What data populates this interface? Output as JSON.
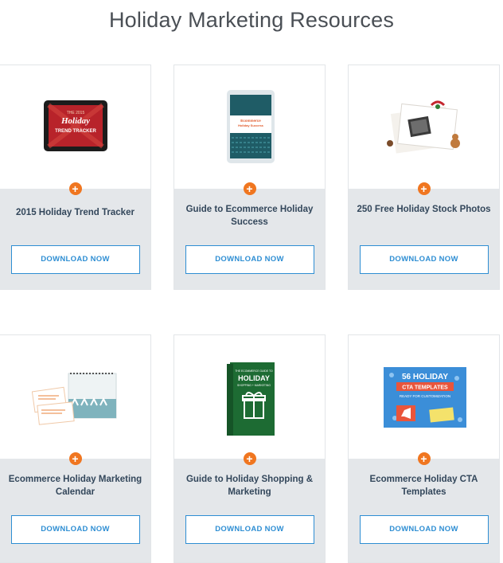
{
  "page": {
    "title": "Holiday Marketing Resources"
  },
  "cards": [
    {
      "title": "2015 Holiday Trend Tracker",
      "button": "DOWNLOAD NOW",
      "plus": "+",
      "thumb": {
        "line1": "THE 2015",
        "line2": "Holiday",
        "line3": "TREND TRACKER"
      }
    },
    {
      "title": "Guide to Ecommerce Holiday Success",
      "button": "DOWNLOAD NOW",
      "plus": "+",
      "thumb": {
        "line1": "Ecommerce",
        "line2": "Holiday Success"
      }
    },
    {
      "title": "250 Free Holiday Stock Photos",
      "button": "DOWNLOAD NOW",
      "plus": "+"
    },
    {
      "title": "Ecommerce Holiday Marketing Calendar",
      "button": "DOWNLOAD NOW",
      "plus": "+"
    },
    {
      "title": "Guide to Holiday Shopping & Marketing",
      "button": "DOWNLOAD NOW",
      "plus": "+",
      "thumb": {
        "line1": "THE ECOMMERCE GUIDE TO",
        "line2": "HOLIDAY",
        "line3": "SHOPPING + MARKETING"
      }
    },
    {
      "title": "Ecommerce Holiday CTA Templates",
      "button": "DOWNLOAD NOW",
      "plus": "+",
      "thumb": {
        "line1": "56 HOLIDAY",
        "line2": "CTA TEMPLATES",
        "line3": "READY FOR CUSTOMIZATION"
      }
    }
  ],
  "colors": {
    "accent_orange": "#f07620",
    "button_blue": "#2e8ed3",
    "card_bottom": "#e4e7ea",
    "title_text": "#33475b"
  },
  "icons": {
    "plus_badge": "plus-circle-icon"
  }
}
